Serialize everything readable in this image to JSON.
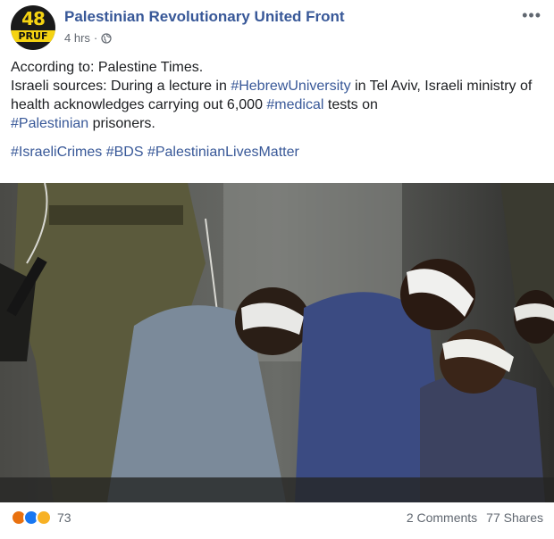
{
  "page": {
    "avatar_top": "48",
    "avatar_bottom": "PRUF",
    "name": "Palestinian Revolutionary United Front",
    "time": "4 hrs",
    "separator": "·"
  },
  "post": {
    "line1": "According to: Palestine Times.",
    "line2_pre": "Israeli sources: During a lecture in ",
    "tag_university": "#HebrewUniversity",
    "line2_mid": " in Tel Aviv, Israeli ministry of health acknowledges carrying out 6,000 ",
    "tag_medical": "#medical",
    "line2_post": " tests on ",
    "tag_palestinian": "#Palestinian",
    "line2_end": " prisoners.",
    "tag_crimes": "#IsraeliCrimes",
    "tag_bds": "#BDS",
    "tag_lives": "#PalestinianLivesMatter"
  },
  "footer": {
    "reaction_count": "73",
    "comments": "2 Comments",
    "shares": "77 Shares"
  },
  "colors": {
    "link": "#385898",
    "accent_yellow": "#f5d312"
  }
}
